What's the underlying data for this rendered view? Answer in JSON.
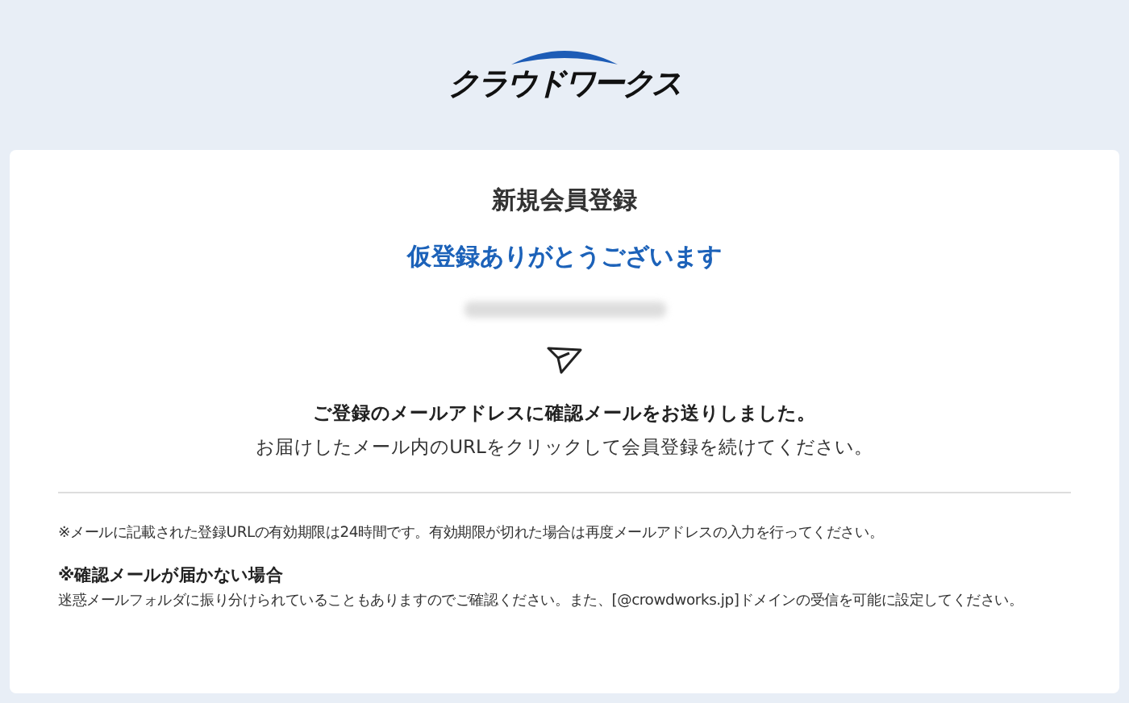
{
  "header": {
    "logo": "クラウドワークス"
  },
  "card": {
    "title": "新規会員登録",
    "heading": "仮登録ありがとうございます",
    "message_bold": "ご登録のメールアドレスに確認メールをお送りしました。",
    "message": "お届けしたメール内のURLをクリックして会員登録を続けてください。"
  },
  "notes": [
    {
      "kind": "text",
      "text": "※メールに記載された登録URLの有効期限は24時間です。有効期限が切れた場合は再度メールアドレスの入力を行ってください。"
    },
    {
      "kind": "heading",
      "text": "※確認メールが届かない場合"
    },
    {
      "kind": "text",
      "text": "迷惑メールフォルダに振り分けられていることもありますのでご確認ください。また、[@crowdworks.jp]ドメインの受信を可能に設定してください。"
    }
  ]
}
